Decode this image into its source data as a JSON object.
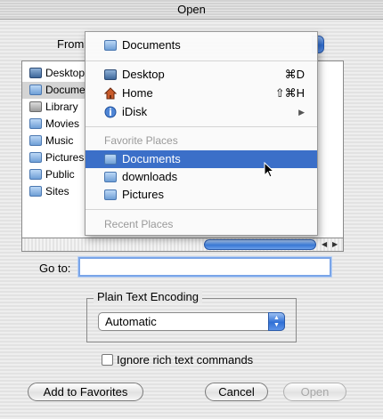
{
  "window": {
    "title": "Open"
  },
  "from": {
    "label": "From:"
  },
  "browser": {
    "items": [
      {
        "label": "Desktop",
        "icon": "desktop-icon"
      },
      {
        "label": "Documents",
        "icon": "folder-icon",
        "selected": true
      },
      {
        "label": "Library",
        "icon": "library-icon"
      },
      {
        "label": "Movies",
        "icon": "folder-icon"
      },
      {
        "label": "Music",
        "icon": "folder-icon"
      },
      {
        "label": "Pictures",
        "icon": "folder-icon"
      },
      {
        "label": "Public",
        "icon": "folder-icon"
      },
      {
        "label": "Sites",
        "icon": "folder-icon"
      }
    ]
  },
  "menu": {
    "current": "Documents",
    "items": [
      {
        "label": "Desktop",
        "shortcut": "⌘D"
      },
      {
        "label": "Home",
        "shortcut": "⇧⌘H"
      },
      {
        "label": "iDisk",
        "shortcut": "▶"
      }
    ],
    "favorites_header": "Favorite Places",
    "favorites": [
      {
        "label": "Documents"
      },
      {
        "label": "downloads"
      },
      {
        "label": "Pictures"
      }
    ],
    "recent_header": "Recent Places"
  },
  "goto": {
    "label": "Go to:",
    "value": ""
  },
  "encoding": {
    "title": "Plain Text Encoding",
    "value": "Automatic"
  },
  "ignore_rich": {
    "label": "Ignore rich text commands",
    "checked": false
  },
  "buttons": {
    "add_favorites": "Add to Favorites",
    "cancel": "Cancel",
    "open": "Open"
  },
  "colors": {
    "highlight": "#3b6fc8",
    "aqua_blue": "#2f6fd6"
  }
}
